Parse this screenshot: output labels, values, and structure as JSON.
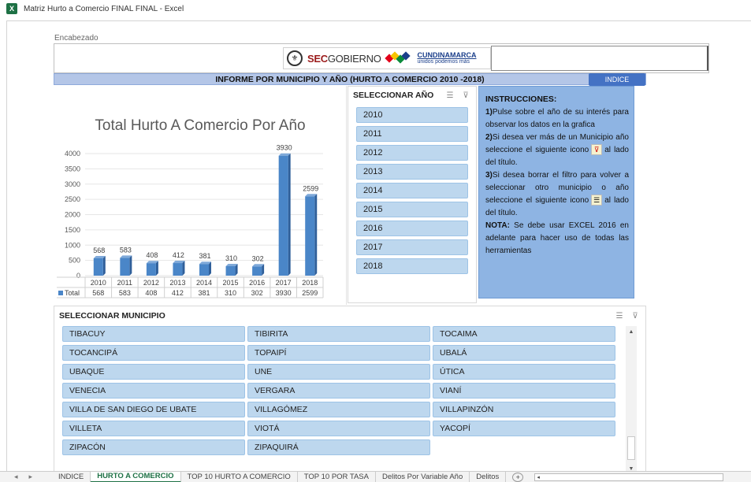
{
  "window": {
    "title": "Matriz Hurto a Comercio FINAL FINAL - Excel"
  },
  "header": {
    "label": "Encabezado",
    "logo_seal_icon": "government-seal-icon",
    "logo_sec": "SEC",
    "logo_gobierno": "GOBIERNO",
    "logo_cund": "CUNDINAMARCA",
    "logo_cund_tag": "unidos podemos más"
  },
  "report": {
    "title": "INFORME POR MUNICIPIO Y AÑO  (HURTO A COMERCIO 2010 -2018)",
    "indice_button": "INDICE"
  },
  "chart_data": {
    "type": "bar",
    "title": "Total Hurto A Comercio Por Año",
    "categories": [
      "2010",
      "2011",
      "2012",
      "2013",
      "2014",
      "2015",
      "2016",
      "2017",
      "2018"
    ],
    "series": [
      {
        "name": "Total",
        "values": [
          568,
          583,
          408,
          412,
          381,
          310,
          302,
          3930,
          2599
        ]
      }
    ],
    "ylim": [
      0,
      4000
    ],
    "yticks": [
      0,
      500,
      1000,
      1500,
      2000,
      2500,
      3000,
      3500,
      4000
    ],
    "bar_color": "#4a86c8",
    "data_table": true
  },
  "year_slicer": {
    "title": "SELECCIONAR AÑO",
    "items": [
      "2010",
      "2011",
      "2012",
      "2013",
      "2014",
      "2015",
      "2016",
      "2017",
      "2018"
    ]
  },
  "instructions": {
    "title": "INSTRUCCIONES:",
    "p1_num": "1)",
    "p1": "Pulse sobre el año de su interés para observar los datos en la grafica",
    "p2_num": "2)",
    "p2a": "Si desea ver más de un Municipio año seleccione el siguiente icono",
    "p2b": "al lado del título.",
    "p3_num": "3)",
    "p3a": "Si desea borrar el filtro para volver a seleccionar otro municipio o año seleccione el siguiente icono",
    "p3b": "al lado del título.",
    "nota_label": "NOTA:",
    "nota": " Se debe usar EXCEL 2016 en adelante para hacer uso de todas las herramientas"
  },
  "muni_slicer": {
    "title": "SELECCIONAR MUNICIPIO",
    "items": [
      "TIBACUY",
      "TIBIRITA",
      "TOCAIMA",
      "TOCANCIPÁ",
      "TOPAIPÍ",
      "UBALÁ",
      "UBAQUE",
      "UNE",
      "ÚTICA",
      "VENECIA",
      "VERGARA",
      "VIANÍ",
      "VILLA DE SAN DIEGO DE UBATE",
      "VILLAGÓMEZ",
      "VILLAPINZÓN",
      "VILLETA",
      "VIOTÁ",
      "YACOPÍ",
      "ZIPACÓN",
      "ZIPAQUIRÁ"
    ]
  },
  "sheet_tabs": {
    "tabs": [
      "INDICE",
      "HURTO A COMERCIO",
      "TOP 10 HURTO A COMERCIO",
      "TOP 10 POR TASA",
      "Delitos Por Variable Año",
      "Delitos"
    ],
    "active": "HURTO A COMERCIO",
    "add_label": "+"
  }
}
